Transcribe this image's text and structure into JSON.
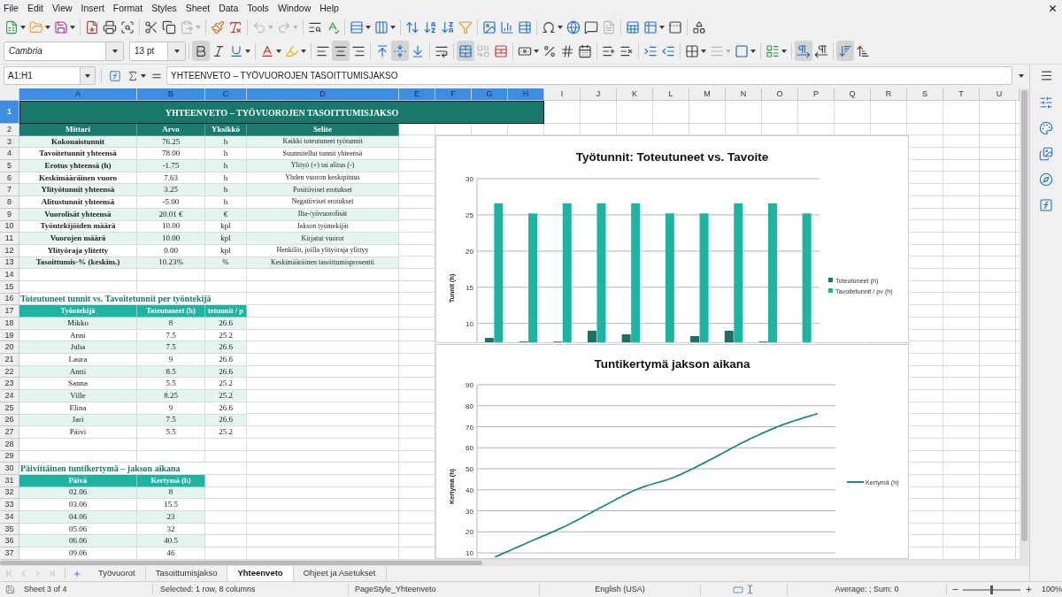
{
  "menu": [
    "File",
    "Edit",
    "View",
    "Insert",
    "Format",
    "Styles",
    "Sheet",
    "Data",
    "Tools",
    "Window",
    "Help"
  ],
  "standard_toolbar": {
    "groups": [
      {
        "items": [
          {
            "kind": "new",
            "disabled": false
          },
          {
            "kind": "open",
            "disabled": false
          },
          {
            "kind": "save",
            "disabled": false
          }
        ]
      },
      {
        "items": [
          {
            "kind": "export_pdf",
            "disabled": false
          },
          {
            "kind": "print",
            "disabled": false
          },
          {
            "kind": "print_preview",
            "disabled": false
          }
        ]
      },
      {
        "items": [
          {
            "kind": "cut",
            "disabled": false
          },
          {
            "kind": "copy",
            "disabled": false
          },
          {
            "kind": "paste",
            "disabled": true
          }
        ]
      },
      {
        "items": [
          {
            "kind": "clone_formatting",
            "disabled": false
          },
          {
            "kind": "clear_formatting",
            "disabled": false
          }
        ]
      },
      {
        "items": [
          {
            "kind": "undo",
            "disabled": true
          },
          {
            "kind": "redo",
            "disabled": true
          }
        ]
      },
      {
        "items": [
          {
            "kind": "find_replace",
            "disabled": false
          },
          {
            "kind": "spelling",
            "disabled": false
          }
        ]
      },
      {
        "items": [
          {
            "kind": "row",
            "disabled": false
          },
          {
            "kind": "column",
            "disabled": false
          }
        ]
      },
      {
        "items": [
          {
            "kind": "sort",
            "disabled": false
          },
          {
            "kind": "sort_ascending",
            "disabled": false
          },
          {
            "kind": "sort_descending",
            "disabled": false
          },
          {
            "kind": "autofilter",
            "disabled": false
          }
        ]
      },
      {
        "items": [
          {
            "kind": "image",
            "disabled": false
          },
          {
            "kind": "chart",
            "disabled": false
          },
          {
            "kind": "pivot_table",
            "disabled": false
          }
        ]
      },
      {
        "items": [
          {
            "kind": "special_character",
            "disabled": false
          },
          {
            "kind": "hyperlink",
            "disabled": false
          },
          {
            "kind": "comment",
            "disabled": false
          },
          {
            "kind": "header_footer",
            "disabled": true
          }
        ]
      },
      {
        "items": [
          {
            "kind": "print_area",
            "disabled": false
          },
          {
            "kind": "freeze",
            "disabled": false
          },
          {
            "kind": "split_window",
            "disabled": false
          }
        ]
      },
      {
        "items": [
          {
            "kind": "draw_functions",
            "disabled": false
          }
        ]
      }
    ]
  },
  "formatting_toolbar": {
    "font_name": "Cambria",
    "font_size": "13 pt",
    "groups": [
      {
        "items": [
          {
            "kind": "bold",
            "pressed": true,
            "disabled": false
          },
          {
            "kind": "italic",
            "pressed": false,
            "disabled": false
          },
          {
            "kind": "underline",
            "pressed": false,
            "disabled": false
          }
        ]
      },
      {
        "items": [
          {
            "kind": "font_color",
            "pressed": false,
            "disabled": false
          },
          {
            "kind": "highlight",
            "pressed": false,
            "disabled": false
          }
        ]
      },
      {
        "items": [
          {
            "kind": "align_left",
            "pressed": false,
            "disabled": false
          },
          {
            "kind": "align_center",
            "pressed": true,
            "disabled": false
          },
          {
            "kind": "align_right",
            "pressed": false,
            "disabled": false
          }
        ]
      },
      {
        "items": [
          {
            "kind": "align_top",
            "pressed": false,
            "disabled": false
          },
          {
            "kind": "align_middle",
            "pressed": true,
            "disabled": false
          },
          {
            "kind": "align_bottom",
            "pressed": false,
            "disabled": false
          }
        ]
      },
      {
        "items": [
          {
            "kind": "wrap_text",
            "pressed": false,
            "disabled": false
          }
        ]
      },
      {
        "items": [
          {
            "kind": "merge_center",
            "pressed": true,
            "disabled": false
          },
          {
            "kind": "merge_cells",
            "pressed": false,
            "disabled": true
          },
          {
            "kind": "unmerge_cells",
            "pressed": false,
            "disabled": false
          }
        ]
      },
      {
        "items": [
          {
            "kind": "currency",
            "pressed": false,
            "disabled": false
          },
          {
            "kind": "percent",
            "pressed": false,
            "disabled": false
          },
          {
            "kind": "number",
            "pressed": false,
            "disabled": false
          },
          {
            "kind": "date",
            "pressed": false,
            "disabled": false
          }
        ]
      },
      {
        "items": [
          {
            "kind": "add_decimal",
            "pressed": false,
            "disabled": false
          },
          {
            "kind": "delete_decimal",
            "pressed": false,
            "disabled": false
          }
        ]
      },
      {
        "items": [
          {
            "kind": "indent_increase",
            "pressed": false,
            "disabled": false
          },
          {
            "kind": "indent_decrease",
            "pressed": false,
            "disabled": false
          }
        ]
      },
      {
        "items": [
          {
            "kind": "borders",
            "pressed": false,
            "disabled": false
          },
          {
            "kind": "border_style",
            "pressed": false,
            "disabled": true
          },
          {
            "kind": "border_color",
            "pressed": false,
            "disabled": false
          }
        ]
      },
      {
        "items": [
          {
            "kind": "conditional",
            "pressed": false,
            "disabled": false
          }
        ]
      },
      {
        "items": [
          {
            "kind": "ltr",
            "pressed": true,
            "disabled": false
          },
          {
            "kind": "rtl",
            "pressed": false,
            "disabled": false
          }
        ]
      },
      {
        "items": [
          {
            "kind": "text_ttb",
            "pressed": true,
            "disabled": false
          },
          {
            "kind": "text_btt",
            "pressed": false,
            "disabled": false
          }
        ]
      }
    ]
  },
  "formula_bar": {
    "name_box": "A1:H1",
    "content": "YHTEENVETO – TYÖVUOROJEN TASOITTUMISJAKSO"
  },
  "sheet": {
    "columns": [
      {
        "label": "A",
        "selected": true
      },
      {
        "label": "B",
        "selected": true
      },
      {
        "label": "C",
        "selected": true
      },
      {
        "label": "D",
        "selected": true
      },
      {
        "label": "E",
        "selected": true
      },
      {
        "label": "F",
        "selected": true
      },
      {
        "label": "G",
        "selected": true
      },
      {
        "label": "H",
        "selected": true
      },
      {
        "label": "I",
        "selected": false
      },
      {
        "label": "J",
        "selected": false
      },
      {
        "label": "K",
        "selected": false
      },
      {
        "label": "L",
        "selected": false
      },
      {
        "label": "M",
        "selected": false
      },
      {
        "label": "N",
        "selected": false
      },
      {
        "label": "O",
        "selected": false
      },
      {
        "label": "P",
        "selected": false
      },
      {
        "label": "Q",
        "selected": false
      },
      {
        "label": "R",
        "selected": false
      },
      {
        "label": "S",
        "selected": false
      },
      {
        "label": "T",
        "selected": false
      },
      {
        "label": "U",
        "selected": false
      }
    ],
    "rows": [
      {
        "number": "1",
        "selected": true,
        "kind": "banner",
        "cells": [
          "YHTEENVETO – TYÖVUOROJEN TASOITTUMISJAKSO"
        ]
      },
      {
        "number": "2",
        "selected": false,
        "kind": "header",
        "cells": [
          "Mittari",
          "Arvo",
          "Yksikkö",
          "Selite"
        ]
      },
      {
        "number": "3",
        "selected": false,
        "kind": "metric",
        "cells": [
          "Kokonaistunnit",
          "76.25",
          "h",
          "Kaikki toteutuneet työtunnit"
        ]
      },
      {
        "number": "4",
        "selected": false,
        "kind": "metric",
        "cells": [
          "Tavoitetunnit yhteensä",
          "78.00",
          "h",
          "Suunnitellut tunnit yhteensä"
        ]
      },
      {
        "number": "5",
        "selected": false,
        "kind": "metric",
        "cells": [
          "Erotus yhteensä (h)",
          "-1.75",
          "h",
          "Ylityö (+) tai alitus (-)"
        ]
      },
      {
        "number": "6",
        "selected": false,
        "kind": "metric",
        "cells": [
          "Keskimääräinen vuoro",
          "7.63",
          "h",
          "Yhden vuoron keskipituus"
        ]
      },
      {
        "number": "7",
        "selected": false,
        "kind": "metric",
        "cells": [
          "Ylityötunnit yhteensä",
          "3.25",
          "h",
          "Positiiviset erotukset"
        ]
      },
      {
        "number": "8",
        "selected": false,
        "kind": "metric",
        "cells": [
          "Alitustunnit yhteensä",
          "-5.00",
          "h",
          "Negatiiviset erotukset"
        ]
      },
      {
        "number": "9",
        "selected": false,
        "kind": "metric",
        "cells": [
          "Vuorolisät yhteensä",
          "20.01 €",
          "€",
          "Ilta-/yövuorolisät"
        ]
      },
      {
        "number": "10",
        "selected": false,
        "kind": "metric",
        "cells": [
          "Työntekijöiden määrä",
          "10.00",
          "kpl",
          "Jakson työntekijät"
        ]
      },
      {
        "number": "11",
        "selected": false,
        "kind": "metric",
        "cells": [
          "Vuorojen määrä",
          "10.00",
          "kpl",
          "Kirjatut vuorot"
        ]
      },
      {
        "number": "12",
        "selected": false,
        "kind": "metric",
        "cells": [
          "Ylityöraja ylitetty",
          "0.00",
          "kpl",
          "Henkilöt, joilla ylityöraja ylittyy"
        ]
      },
      {
        "number": "13",
        "selected": false,
        "kind": "metric",
        "cells": [
          "Tasoittumis-% (keskim.)",
          "10.23%",
          "%",
          "Keskimääräinen tasoittumisprosentti"
        ]
      },
      {
        "number": "14",
        "selected": false,
        "kind": "empty"
      },
      {
        "number": "15",
        "selected": false,
        "kind": "empty"
      },
      {
        "number": "16",
        "selected": false,
        "kind": "section",
        "cells": [
          "Toteutuneet tunnit vs. Tavoitetunnit per työntekijä"
        ]
      },
      {
        "number": "17",
        "selected": false,
        "kind": "subheader",
        "cells": [
          "Työntekijä",
          "Toteutuneet (h)",
          "tetunnit / p"
        ]
      },
      {
        "number": "18",
        "selected": false,
        "kind": "record",
        "cells": [
          "Mikko",
          "8",
          "26.6"
        ]
      },
      {
        "number": "19",
        "selected": false,
        "kind": "record",
        "cells": [
          "Anni",
          "7.5",
          "25.2"
        ]
      },
      {
        "number": "20",
        "selected": false,
        "kind": "record",
        "cells": [
          "Juha",
          "7.5",
          "26.6"
        ]
      },
      {
        "number": "21",
        "selected": false,
        "kind": "record",
        "cells": [
          "Laura",
          "9",
          "26.6"
        ]
      },
      {
        "number": "22",
        "selected": false,
        "kind": "record",
        "cells": [
          "Antti",
          "8.5",
          "26.6"
        ]
      },
      {
        "number": "23",
        "selected": false,
        "kind": "record",
        "cells": [
          "Sanna",
          "5.5",
          "25.2"
        ]
      },
      {
        "number": "24",
        "selected": false,
        "kind": "record",
        "cells": [
          "Ville",
          "8.25",
          "25.2"
        ]
      },
      {
        "number": "25",
        "selected": false,
        "kind": "record",
        "cells": [
          "Elina",
          "9",
          "26.6"
        ]
      },
      {
        "number": "26",
        "selected": false,
        "kind": "record",
        "cells": [
          "Jari",
          "7.5",
          "26.6"
        ]
      },
      {
        "number": "27",
        "selected": false,
        "kind": "record",
        "cells": [
          "Päivi",
          "5.5",
          "25.2"
        ]
      },
      {
        "number": "28",
        "selected": false,
        "kind": "empty"
      },
      {
        "number": "29",
        "selected": false,
        "kind": "empty"
      },
      {
        "number": "30",
        "selected": false,
        "kind": "section",
        "cells": [
          "Päivittäinen tuntikertymä – jakson aikana"
        ]
      },
      {
        "number": "31",
        "selected": false,
        "kind": "subheader",
        "cells": [
          "Päivä",
          "Kertymä (h)"
        ]
      },
      {
        "number": "32",
        "selected": false,
        "kind": "record",
        "cells": [
          "02.06",
          "8"
        ]
      },
      {
        "number": "33",
        "selected": false,
        "kind": "record",
        "cells": [
          "03.06",
          "15.5"
        ]
      },
      {
        "number": "34",
        "selected": false,
        "kind": "record",
        "cells": [
          "04.06",
          "23"
        ]
      },
      {
        "number": "35",
        "selected": false,
        "kind": "record",
        "cells": [
          "05.06",
          "32"
        ]
      },
      {
        "number": "36",
        "selected": false,
        "kind": "record",
        "cells": [
          "06.06",
          "40.5"
        ]
      },
      {
        "number": "37",
        "selected": false,
        "kind": "record",
        "cells": [
          "09.06",
          "46"
        ]
      }
    ],
    "charts": [
      {
        "chart_data": {
          "type": "bar",
          "title": "Työtunnit: Toteutuneet vs. Tavoite",
          "ylabel": "Tunnit (h)",
          "ylim": [
            7.4,
            30
          ],
          "yticks": [
            {
              "value": 10,
              "label": "10"
            },
            {
              "value": 15,
              "label": "15"
            },
            {
              "value": 20,
              "label": "20"
            },
            {
              "value": 25,
              "label": "25"
            },
            {
              "value": 30,
              "label": "30"
            }
          ],
          "grid": true,
          "legend": true,
          "series": [
            {
              "name": "Toteutuneet (h)",
              "color": "#1d6f66",
              "values": [
                8,
                7.5,
                7.5,
                9,
                8.5,
                null,
                8.25,
                9,
                7.5,
                null
              ]
            },
            {
              "name": "Tavoitetunnit / pv (h)",
              "color": "#1bb5a1",
              "values": [
                26.6,
                25.2,
                26.6,
                26.6,
                26.6,
                25.2,
                25.2,
                26.6,
                26.6,
                25.2
              ]
            }
          ]
        }
      },
      {
        "chart_data": {
          "type": "line",
          "title": "Tuntikertymä jakson aikana",
          "ylabel": "Kertymä (h)",
          "ylim": [
            7.5,
            90
          ],
          "yticks": [
            {
              "value": 10,
              "label": "10"
            },
            {
              "value": 20,
              "label": "20"
            },
            {
              "value": 30,
              "label": "30"
            },
            {
              "value": 40,
              "label": "40"
            },
            {
              "value": 50,
              "label": "50"
            },
            {
              "value": 60,
              "label": "60"
            },
            {
              "value": 70,
              "label": "70"
            },
            {
              "value": 80,
              "label": "80"
            },
            {
              "value": 90,
              "label": "90"
            }
          ],
          "grid": true,
          "legend": true,
          "series": [
            {
              "name": "Kertymä (h)",
              "color": "#1f8a7b",
              "values": [
                8,
                15.5,
                23,
                32,
                40.5,
                46,
                54.25,
                63.25,
                70.75,
                76.25
              ]
            }
          ]
        }
      }
    ]
  },
  "sheet_tabs": [
    {
      "name": "Työvuorot",
      "selected": false
    },
    {
      "name": "Tasoittumisjakso",
      "selected": false
    },
    {
      "name": "Yhteenveto",
      "selected": true
    },
    {
      "name": "Ohjeet ja Asetukset",
      "selected": false
    }
  ],
  "status_bar": {
    "sheet": "Sheet 3 of 4",
    "selection": "Selected: 1 row, 8 columns",
    "page_style": "PageStyle_Yhteenveto",
    "language": "English (USA)",
    "summary": "Average: ; Sum: 0",
    "zoom": {
      "level": 0.5,
      "reading": "100%"
    }
  }
}
